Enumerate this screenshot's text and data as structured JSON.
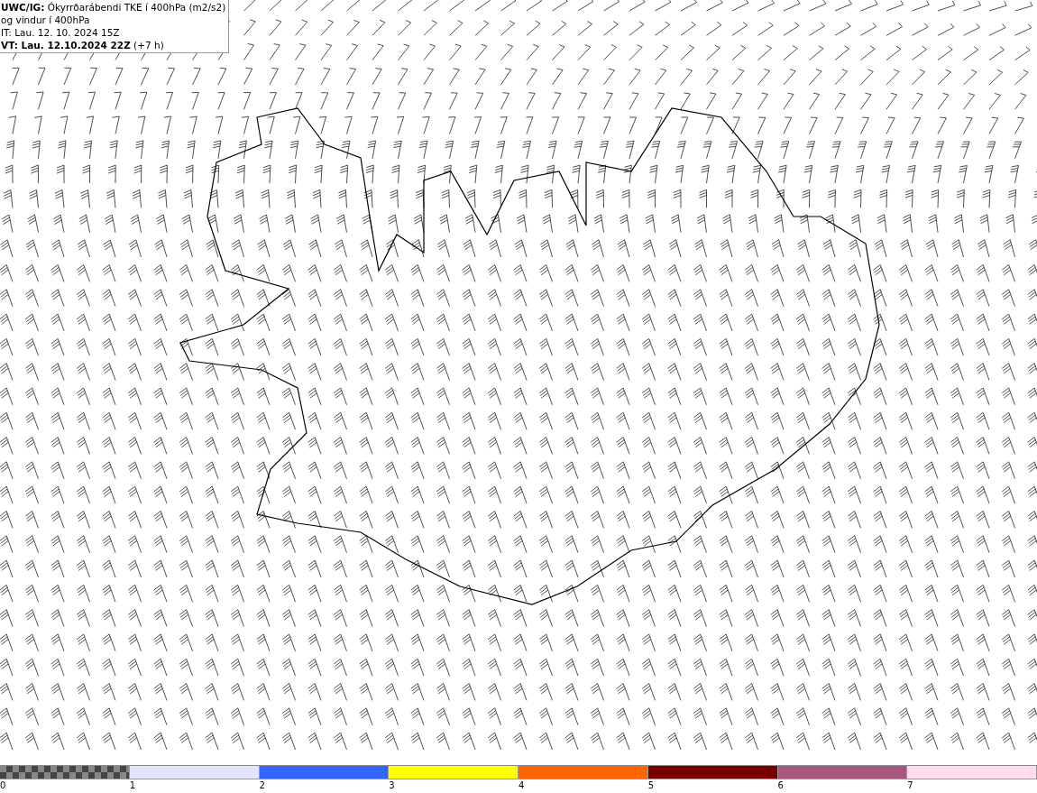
{
  "header": {
    "lines": [
      "**UWC/IG:** Ókyrrðarábendi TKE í 400hPa (m2/s2)",
      "og vindur í 400hPa",
      "IT: Lau. 12. 10. 2024 15Z",
      "**VT: Lau. 12.10.2024 22Z** (+7 h)"
    ]
  },
  "legend": {
    "segments": [
      {
        "kind": "checker",
        "label": "0"
      },
      {
        "kind": "solid",
        "color": "#e4e4fa",
        "label": "1"
      },
      {
        "kind": "solid",
        "color": "#3366ff",
        "label": "2"
      },
      {
        "kind": "solid",
        "color": "#ffff00",
        "label": "3"
      },
      {
        "kind": "solid",
        "color": "#ff6600",
        "label": "4"
      },
      {
        "kind": "solid",
        "color": "#7a0000",
        "label": "5"
      },
      {
        "kind": "solid",
        "color": "#a8557f",
        "label": "6"
      },
      {
        "kind": "solid",
        "color": "#ffdcf0",
        "label": "7"
      }
    ]
  }
}
